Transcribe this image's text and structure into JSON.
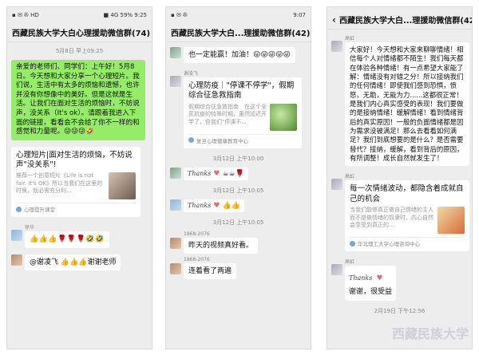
{
  "panel1": {
    "status_left": "▪ ✉ ✇ HD",
    "status_right": "■ 4G 59% 9:25",
    "title": "西藏民族大学大白心理援助微信群(74)",
    "time": "5月8日 早上09:25",
    "green_message": "亲爱的老师们、同学们：上午好！5月8日。今天想和大家分享一个心理短片。我们说，生活中有太多的烦恼和遗憾，也许并没有你想像中的美好。但是这就是生活。让我们在面对生活的烦恼时，不妨说声，没关系（It's ok）。请跟着我进入下面的链接，看看会不会给了你不一样的和感觉和力量呢。😜😜😜🤣",
    "link_title": "心理短片|面对生活的烦恼，不妨说声\"没关系\"!",
    "link_desc": "推荐一个创意短片《Life is not fair. It's OK》所以当我们在这里的时候，就必需充分利...",
    "link_source": "心理提升课堂",
    "sender1": "徐华",
    "reply1": "👍👍👍🌹🌹🌹🤣🤣",
    "reply2": "@谢凌飞 👍👍👍谢谢老师"
  },
  "panel2": {
    "status_left": "▪ ✉ ✇",
    "status_right": "9:07",
    "title": "西藏民族大学大白...理援助微信群(42)",
    "top_bubble": "也一定能赢！加油！😜😜😜😜😜",
    "sender1": "谢凌飞",
    "link_title": "心理防疫｜\"停课不停学\"，假期综合征急救指南",
    "link_desc": "假期综合征急救指南　在这个全民抗疫的特殊时期，虽然延迟开学了，但我们\"停课不...",
    "link_source": "复旦心理健康教育中心",
    "time1": "3月12日 上午10:00",
    "thanks": "Thanks",
    "time2": "3月12日 上午10:05",
    "time3": "3月12日 上午10:05",
    "sender2": "1868-2076",
    "bubble2": "昨天的视频真好看。",
    "sender3": "1868-2076",
    "bubble3": "连着看了两遍"
  },
  "panel3": {
    "back": "‹",
    "title": "西藏民族大学大白...理援助微信群(42)",
    "sender1": "高虹",
    "message1": "大家好！今天想和大家来聊聊情绪！相信每个人对情绪都不陌生！我们每天都在体验各种情绪！有一点希望大家能了解：情绪没有对错之分！所以接纳我们的任何情绪！即使我们感到恐惧，愤怒，无助，无能为力......这都很正常！是我们内心真实感受的表现！我们要做的是接纳情绪！缓解情绪！看到情绪背后的真实原因！一般的负面情绪都是因为需求没被满足！那么去看看如何满足？我们到底想要的是什么？是否需要替代？接纳，缓解，看到背后的原因，有所调整！成长自然就发生了！",
    "sender2": "高虹",
    "link_title": "每一次情绪波动，都隐含着成就自己的机会",
    "link_desc": "当我们能够真正做自己情绪的主人而不是做情绪的奴隶时，内心自然会享受到真正的...",
    "link_source": "华北理工大学心理咨询中心",
    "sender3": "高虹",
    "thanks": "Thanks",
    "bubble3": "谢谢，很受益",
    "time": "2月19日 下午12:56",
    "watermark": "西藏民族大学"
  },
  "colors": {
    "chat_bg": "#ededed",
    "green_bubble": "#95ec69",
    "white_bubble": "#ffffff",
    "heart": "#e36a7a"
  }
}
